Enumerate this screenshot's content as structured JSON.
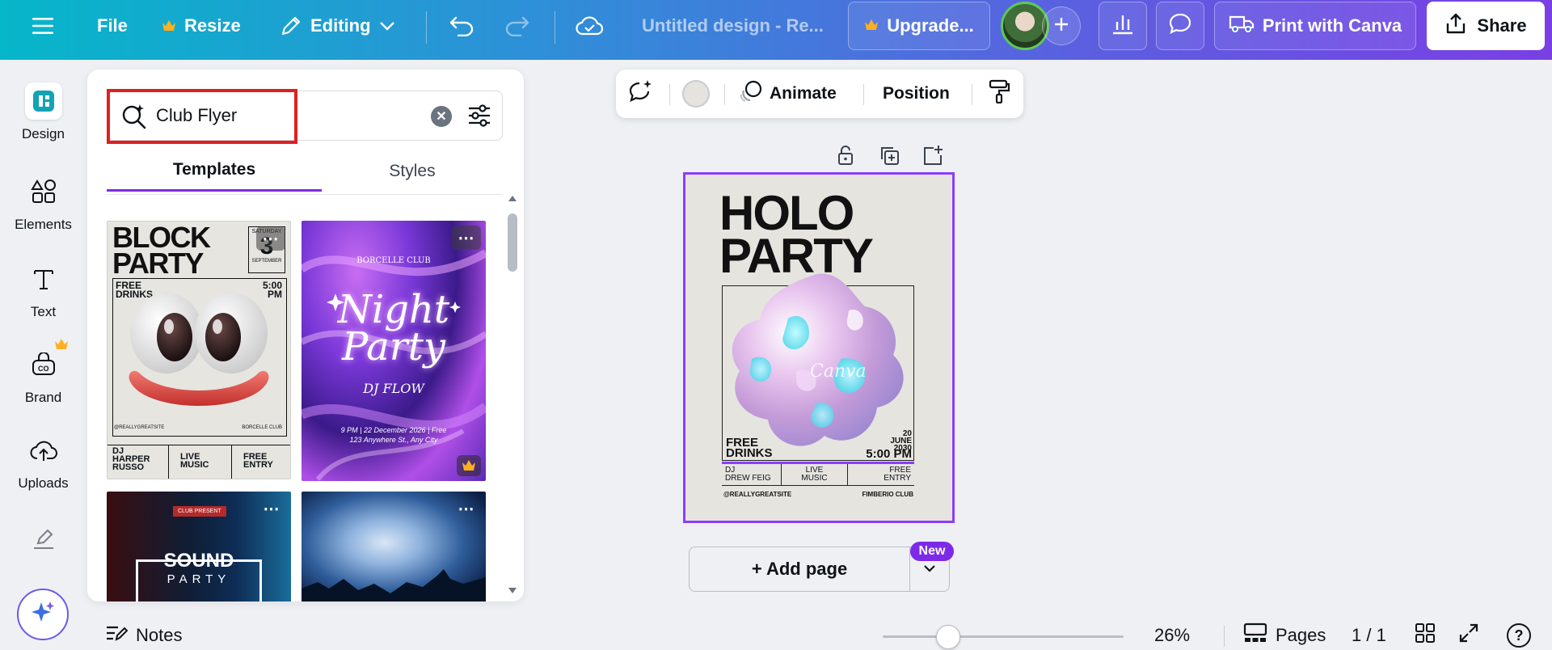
{
  "topbar": {
    "file": "File",
    "resize": "Resize",
    "editing": "Editing",
    "title": "Untitled design - Re...",
    "upgrade": "Upgrade...",
    "print": "Print with Canva",
    "share": "Share"
  },
  "rail": {
    "items": [
      "Design",
      "Elements",
      "Text",
      "Brand",
      "Uploads"
    ]
  },
  "panel": {
    "search_value": "Club Flyer",
    "tabs": [
      "Templates",
      "Styles"
    ],
    "templates": {
      "block_party": {
        "title_line1": "BLOCK",
        "title_line2": "PARTY",
        "num": "3",
        "day": "SATURDAY",
        "month": "SEPTEMBER",
        "free": "FREE",
        "drinks": "DRINKS",
        "time1": "5:00",
        "time2": "PM",
        "site": "@REALLYGREATSITE",
        "club": "BORCELLE CLUB",
        "dj1": "DJ",
        "dj2": "HARPER",
        "dj3": "RUSSO",
        "live1": "LIVE",
        "live2": "MUSIC",
        "entry1": "FREE",
        "entry2": "ENTRY"
      },
      "night_party": {
        "club": "BORCELLE CLUB",
        "line1": "Night",
        "line2": "Party",
        "dj": "DJ FLOW",
        "info1": "9 PM | 22 December 2026 | Free",
        "info2": "123 Anywhere St., Any City"
      },
      "sound_party": {
        "badge": "CLUB PRESENT",
        "title": "SOUND",
        "sub": "PARTY"
      }
    }
  },
  "context_toolbar": {
    "animate": "Animate",
    "position": "Position"
  },
  "page": {
    "title_line1": "HOLO",
    "title_line2": "PARTY",
    "watermark": "Canva",
    "free": "FREE",
    "drinks": "DRINKS",
    "date1": "20 JUNE",
    "date2": "2030",
    "time": "5:00 PM",
    "dj1": "DJ",
    "dj2": "DREW FEIG",
    "live1": "LIVE",
    "live2": "MUSIC",
    "entry1": "FREE",
    "entry2": "ENTRY",
    "site": "@REALLYGREATSITE",
    "club": "FIMBERIO CLUB"
  },
  "add_page": "+ Add page",
  "new_badge": "New",
  "bottom": {
    "notes": "Notes",
    "zoom": "26%",
    "pages": "Pages",
    "page_count": "1 / 1",
    "help": "?"
  },
  "colors": {
    "accent": "#7d2ae8",
    "highlight": "#e02020",
    "crown": "#ffb020"
  },
  "zoom_fraction": 0.26
}
